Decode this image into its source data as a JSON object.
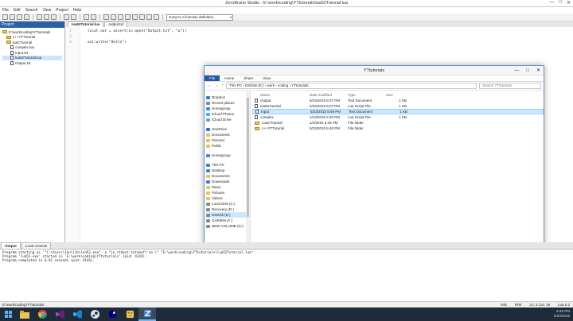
{
  "app": {
    "title": "ZeroBrane Studio - E:\\work\\coding\\YTtutorials\\lua52Tutorial.lua",
    "min": "—",
    "max": "□",
    "close": "✕"
  },
  "menu": [
    "File",
    "Edit",
    "Search",
    "View",
    "Project",
    "Help"
  ],
  "toolbar": {
    "function_dropdown": "Jump to a function definition..."
  },
  "project": {
    "header": "Project",
    "tree": [
      {
        "label": "E:\\work\\coding\\YTtutorials",
        "type": "folder",
        "indent": 0
      },
      {
        "label": "c++YTTutorial",
        "type": "folder",
        "indent": 1
      },
      {
        "label": "luaCTutorial",
        "type": "folder",
        "indent": 1
      },
      {
        "label": "complex.lua",
        "type": "file",
        "indent": 2
      },
      {
        "label": "Input.txt",
        "type": "file",
        "indent": 2
      },
      {
        "label": "lua52Tutorial.lua",
        "type": "file",
        "indent": 2,
        "selected": true
      },
      {
        "label": "Output.txt",
        "type": "file",
        "indent": 2
      }
    ]
  },
  "editor": {
    "tabs": [
      {
        "label": "lua52Tutorial.lua",
        "active": true
      },
      {
        "label": "output.txt",
        "active": false
      }
    ],
    "lines": [
      {
        "n": "1",
        "code": "    local out = assert(io.open(\"Output.txt\", \"w\"))"
      },
      {
        "n": "2",
        "code": ""
      },
      {
        "n": "3",
        "code": "    out:write(\"Hello\")"
      }
    ]
  },
  "explorer": {
    "title": "YTtutorials",
    "ribbon": [
      "File",
      "Home",
      "Share",
      "View"
    ],
    "address": "This PC  ›  DSDisk (E:)  ›  work  ›  coding  ›  YTtutorials",
    "search_placeholder": "Search YTtutorials",
    "nav": [
      {
        "label": "Dropbox",
        "color": "#2e7dd8"
      },
      {
        "label": "Recent places",
        "color": "#888888"
      },
      {
        "label": "Homegroup",
        "color": "#3a8fd0"
      },
      {
        "label": "iCloud Photos",
        "color": "#57a6e8"
      },
      {
        "label": "iCloud Drive",
        "color": "#57a6e8"
      },
      {
        "label": "",
        "gap": true
      },
      {
        "label": "OneDrive",
        "color": "#2e6fd0"
      },
      {
        "label": "Documents",
        "color": "#e8c450"
      },
      {
        "label": "Pictures",
        "color": "#e8c450"
      },
      {
        "label": "Public",
        "color": "#e8c450"
      },
      {
        "label": "",
        "gap": true
      },
      {
        "label": "Homegroup",
        "color": "#3a8fd0"
      },
      {
        "label": "",
        "gap": true
      },
      {
        "label": "This PC",
        "color": "#4a7fb8"
      },
      {
        "label": "Desktop",
        "color": "#3a7fd0"
      },
      {
        "label": "Documents",
        "color": "#e8c450"
      },
      {
        "label": "Downloads",
        "color": "#3a7fd0"
      },
      {
        "label": "Music",
        "color": "#e8c450"
      },
      {
        "label": "Pictures",
        "color": "#e8c450"
      },
      {
        "label": "Videos",
        "color": "#e8c450"
      },
      {
        "label": "Local Disk (C:)",
        "color": "#888888"
      },
      {
        "label": "Recovery (D:)",
        "color": "#888888"
      },
      {
        "label": "DSDisk (E:)",
        "color": "#888888",
        "selected": true
      },
      {
        "label": "GARMIN (F:)",
        "color": "#888888"
      },
      {
        "label": "NEW VOLUME (G:)",
        "color": "#888888"
      }
    ],
    "columns": [
      "Name",
      "Date modified",
      "Type",
      "Size"
    ],
    "rows": [
      {
        "name": "Output",
        "date": "5/23/2015 6:07 PM",
        "type": "Text Document",
        "size": "1 KB",
        "icon": "file"
      },
      {
        "name": "lua52Tutorial",
        "date": "5/23/2015 6:07 PM",
        "type": "Lua Script File",
        "size": "1 KB",
        "icon": "file"
      },
      {
        "name": "Input",
        "date": "5/23/2015 5:59 PM",
        "type": "Text Document",
        "size": "1 KB",
        "icon": "file",
        "selected": true
      },
      {
        "name": "complex",
        "date": "1/13/2015 2:30 PM",
        "type": "Lua Script File",
        "size": "1 KB",
        "icon": "file"
      },
      {
        "name": "LuaCTutorial",
        "date": "1/4/2015 3:45 PM",
        "type": "File folder",
        "size": "",
        "icon": "folder"
      },
      {
        "name": "c++YTTutorial",
        "date": "5/23/2015 5:40 PM",
        "type": "File folder",
        "size": "",
        "icon": "folder"
      }
    ],
    "status_items": "6 items",
    "status_selected": "1 item selected  0 bytes"
  },
  "output": {
    "tabs": [
      {
        "label": "Output",
        "active": true
      },
      {
        "label": "Local console",
        "active": false
      }
    ],
    "lines": [
      "Program starting as '\"C:\\Users\\Ian\\lib\\lua52.exe\" -e \"io.stdout:setvbuf('no')\" \"E:\\work\\coding\\YTtutorials\\lua52Tutorial.lua\"'.",
      "Program 'lua52.exe' started in 'E:\\work\\coding\\YTtutorials' (pid: 4144).",
      "Program completed in 0.01 seconds (pid: 4144)."
    ]
  },
  "status": {
    "path": "E:\\work\\coding\\YTtutorials",
    "ins": "INS",
    "rw": "R/W",
    "pos": "Ln: 3 Col: 19",
    "lua": "Lua 5.2"
  },
  "taskbar": {
    "apps": [
      "file-explorer",
      "chrome",
      "visual-studio",
      "visual-studio-code",
      "steam",
      "lua",
      "paint",
      "zerobrane"
    ],
    "tray_time": "8:48 PM",
    "tray_date": "5/23/2015"
  }
}
